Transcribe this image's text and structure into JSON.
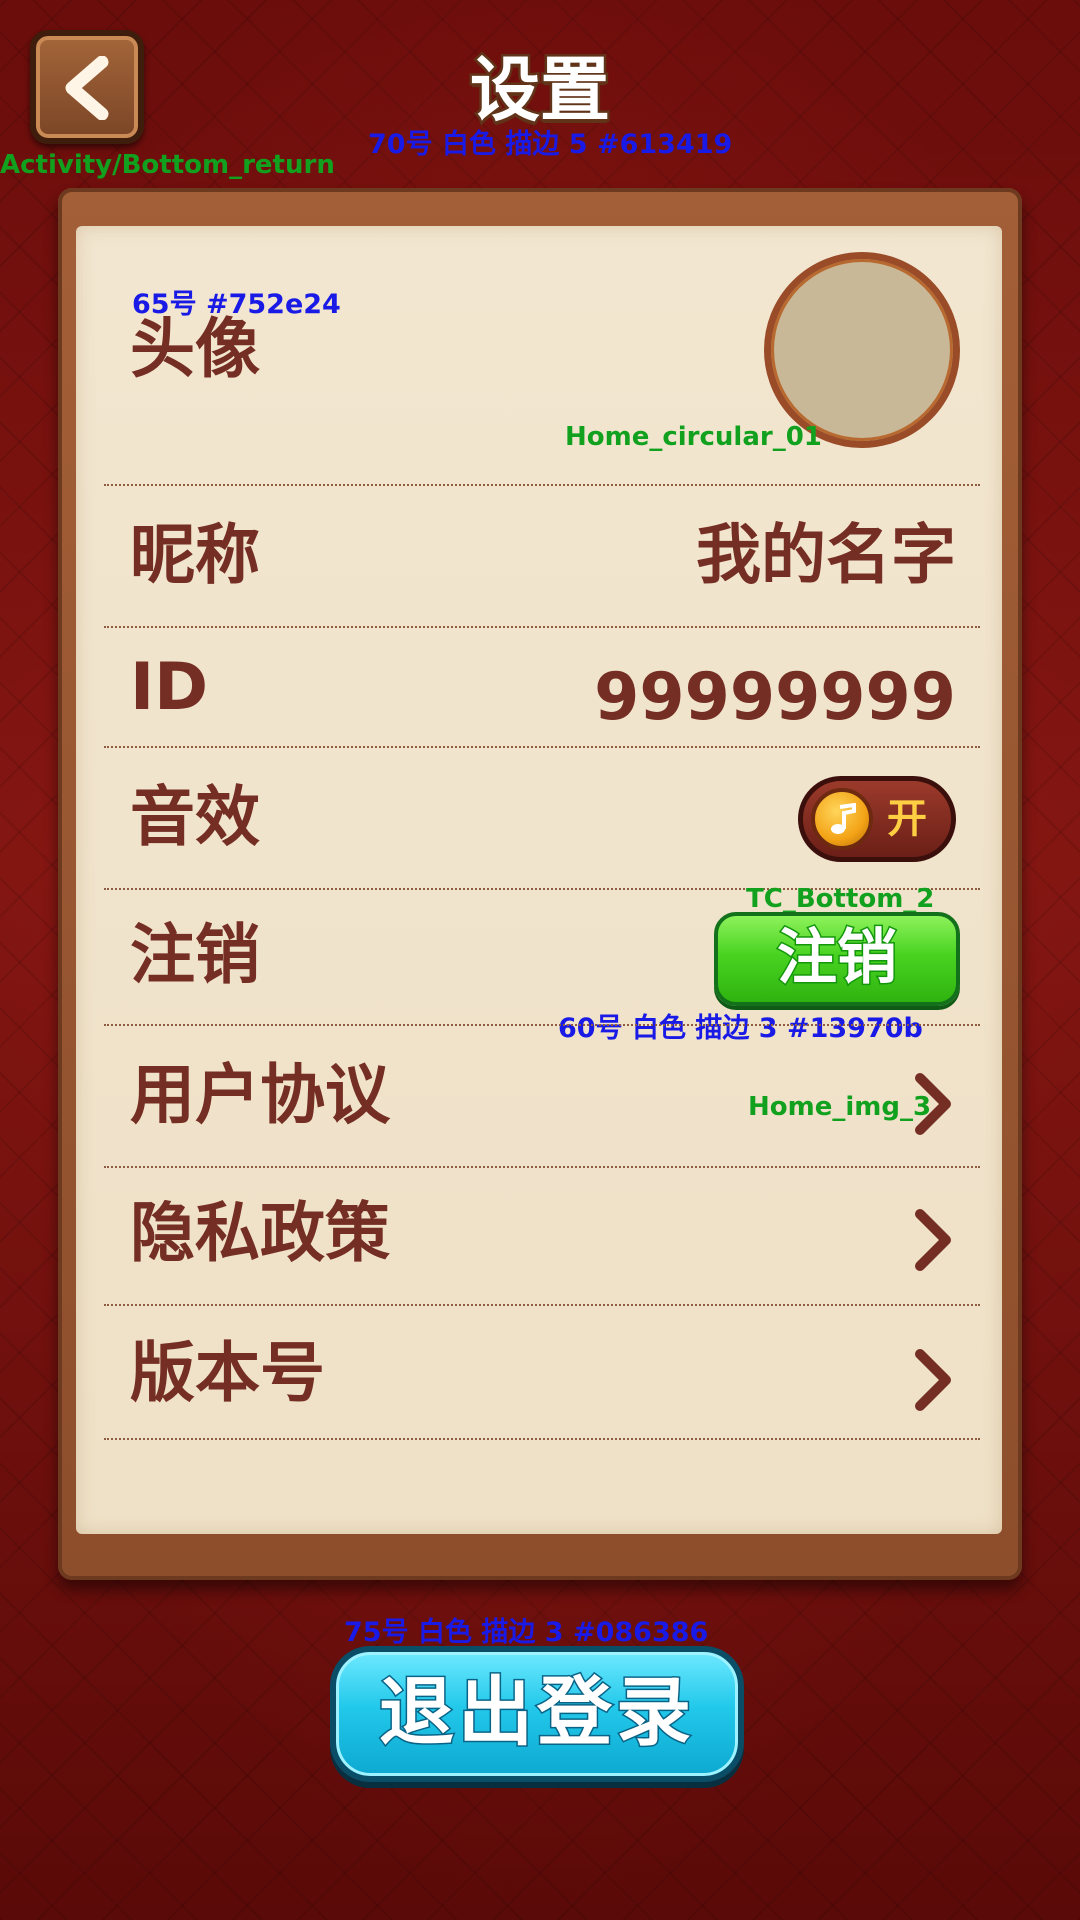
{
  "header": {
    "title": "设置",
    "title_note": "70号  白色  描边 5    #613419",
    "back_asset": "Activity/Bottom_return"
  },
  "avatar_row": {
    "label": "头像",
    "label_note": "65号    #752e24",
    "avatar_asset": "Home_circular_01"
  },
  "nickname_row": {
    "label": "昵称",
    "value": "我的名字"
  },
  "id_row": {
    "label": "ID",
    "value": "99999999"
  },
  "sound_row": {
    "label": "音效",
    "toggle_state": "开",
    "toggle_on": true
  },
  "cancel_row": {
    "label": "注销",
    "button_asset": "TC_Bottom_2",
    "button_label": "注销",
    "button_note": "60号  白色  描边  3    #13970b"
  },
  "agreement_row": {
    "label": "用户协议",
    "arrow_asset": "Home_img_3"
  },
  "privacy_row": {
    "label": "隐私政策"
  },
  "version_row": {
    "label": "版本号"
  },
  "logout": {
    "note": "75号  白色  描边  3    #086386",
    "label": "退出登录"
  },
  "colors": {
    "label_text": "#752e24",
    "title_stroke": "#613419",
    "green_stroke": "#13970b",
    "cyan_stroke": "#086386",
    "annotation_green": "#12a11e",
    "annotation_blue": "#1a1ae6"
  },
  "icons": [
    "back-arrow-icon",
    "music-note-icon",
    "chevron-right-icon"
  ]
}
